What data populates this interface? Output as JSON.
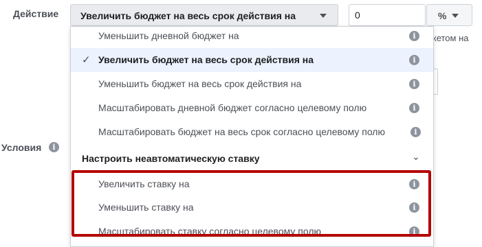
{
  "action": {
    "label": "Действие",
    "selected": "Увеличить бюджет на весь срок действия на",
    "amount": "0",
    "unit": "%"
  },
  "conditions": {
    "label": "Условия"
  },
  "background_fragment": "жетом на",
  "dropdown": {
    "options": [
      {
        "label": "Уменьшить дневной бюджет на",
        "selected": false
      },
      {
        "label": "Увеличить бюджет на весь срок действия на",
        "selected": true
      },
      {
        "label": "Уменьшить бюджет на весь срок действия на",
        "selected": false
      },
      {
        "label": "Масштабировать дневной бюджет согласно целевому полю",
        "selected": false
      },
      {
        "label": "Масштабировать бюджет на весь срок согласно целевому полю",
        "selected": false
      }
    ],
    "group": {
      "label": "Настроить неавтоматическую ставку",
      "options": [
        {
          "label": "Увеличить ставку на"
        },
        {
          "label": "Уменьшить ставку на"
        },
        {
          "label": "Масштабировать ставку согласно целевому полю"
        }
      ]
    }
  },
  "colors": {
    "highlight": "#b30000",
    "selected_bg": "#ecf3ff"
  },
  "icons": {
    "info": "info-icon",
    "check": "check-icon",
    "caret": "caret-down-icon",
    "chevron": "chevron-down-icon"
  }
}
